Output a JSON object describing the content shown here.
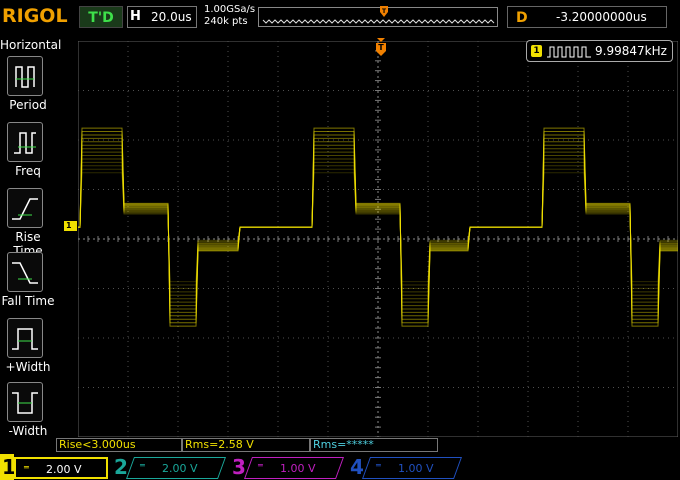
{
  "header": {
    "brand": "RIGOL",
    "trigger_status": "T'D",
    "horizontal_letter": "H",
    "timebase": "20.0us",
    "sample_rate": "1.00GSa/s",
    "memory_depth": "240k pts",
    "delay_letter": "D",
    "delay_value": "-3.20000000us"
  },
  "sidebar": {
    "title": "Horizontal",
    "items": [
      {
        "label": "Period",
        "icon": "period-icon"
      },
      {
        "label": "Freq",
        "icon": "frequency-icon"
      },
      {
        "label": "Rise Time",
        "icon": "rise-time-icon"
      },
      {
        "label": "Fall Time",
        "icon": "fall-time-icon"
      },
      {
        "label": "+Width",
        "icon": "positive-width-icon"
      },
      {
        "label": "-Width",
        "icon": "negative-width-icon"
      }
    ]
  },
  "frequency_counter": {
    "channel": "1",
    "value": "9.99847kHz"
  },
  "measurements": [
    {
      "text": "Rise<3.000us",
      "color": "#f0e000"
    },
    {
      "text": "Rms=2.58 V",
      "color": "#f0e000"
    },
    {
      "text": "Rms=*****",
      "color": "#4fd0e0"
    }
  ],
  "channels": [
    {
      "num": "1",
      "scale": "2.00 V",
      "color": "#f0e000",
      "active": true
    },
    {
      "num": "2",
      "scale": "2.00 V",
      "color": "#1aa79a",
      "active": false
    },
    {
      "num": "3",
      "scale": "1.00 V",
      "color": "#c020c0",
      "active": false
    },
    {
      "num": "4",
      "scale": "1.00 V",
      "color": "#2050c0",
      "active": false
    }
  ],
  "markers": {
    "ch1_marker": "1",
    "trigger_marker": "T"
  },
  "colors": {
    "ch1": "#f0e000",
    "trigger": "#f08000",
    "grid": "#505050",
    "brand": "#f0a000"
  }
}
